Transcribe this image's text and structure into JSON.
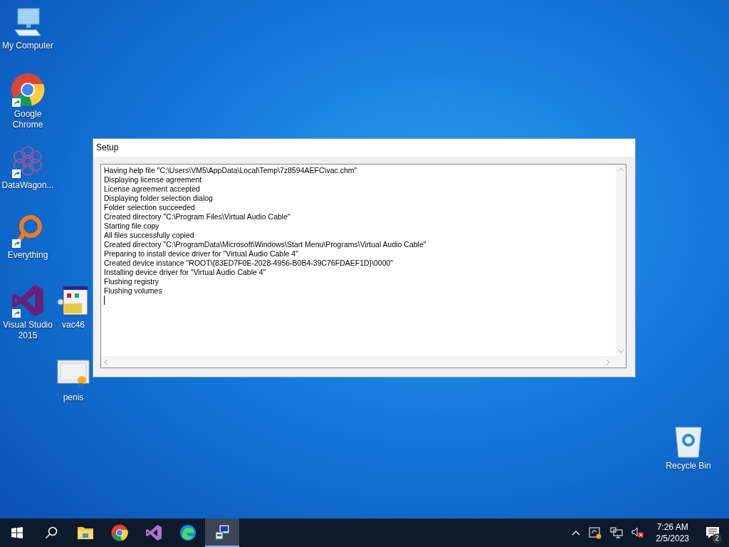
{
  "desktop_icons": [
    {
      "kind": "computer",
      "label": "My Computer",
      "shortcut": false
    },
    {
      "kind": "chrome",
      "label": "Google Chrome",
      "shortcut": true
    },
    {
      "kind": "datawagon",
      "label": "DataWagon...",
      "shortcut": true
    },
    {
      "kind": "everything",
      "label": "Everything",
      "shortcut": true
    },
    {
      "kind": "vs",
      "label": "Visual Studio 2015",
      "shortcut": true
    },
    {
      "kind": "installer",
      "label": "vac46",
      "shortcut": false
    },
    {
      "kind": "certificate",
      "label": "penis",
      "shortcut": false
    },
    {
      "kind": "recycle",
      "label": "Recycle Bin",
      "shortcut": false
    }
  ],
  "window": {
    "title": "Setup",
    "log_lines": [
      "Having help file \"C:\\Users\\VM5\\AppData\\Local\\Temp\\7z8594AEFC\\vac.chm\"",
      "Displaying license agreement",
      "License agreement accepted",
      "Displaying folder selection dialog",
      "Folder selection succeeded",
      "Created directory \"C:\\Program Files\\Virtual Audio Cable\"",
      "Starting file copy",
      "All files successfully copied",
      "Created directory \"C:\\ProgramData\\Microsoft\\Windows\\Start Menu\\Programs\\Virtual Audio Cable\"",
      "Preparing to install device driver for \"Virtual Audio Cable 4\"",
      "Created device instance \"ROOT\\{83ED7F0E-2028-4956-B0B4-39C76FDAEF1D}\\0000\"",
      "Installing device driver for \"Virtual Audio Cable 4\"",
      "Flushing registry",
      "Flushing volumes"
    ]
  },
  "taskbar": {
    "apps": [
      {
        "kind": "explorer",
        "selected": false
      },
      {
        "kind": "chrome",
        "selected": false
      },
      {
        "kind": "vs",
        "selected": false
      },
      {
        "kind": "edge",
        "selected": false
      },
      {
        "kind": "installer",
        "selected": true
      }
    ],
    "clock": {
      "time": "7:26 AM",
      "date": "2/5/2023"
    },
    "notifications": {
      "count": "2"
    }
  }
}
